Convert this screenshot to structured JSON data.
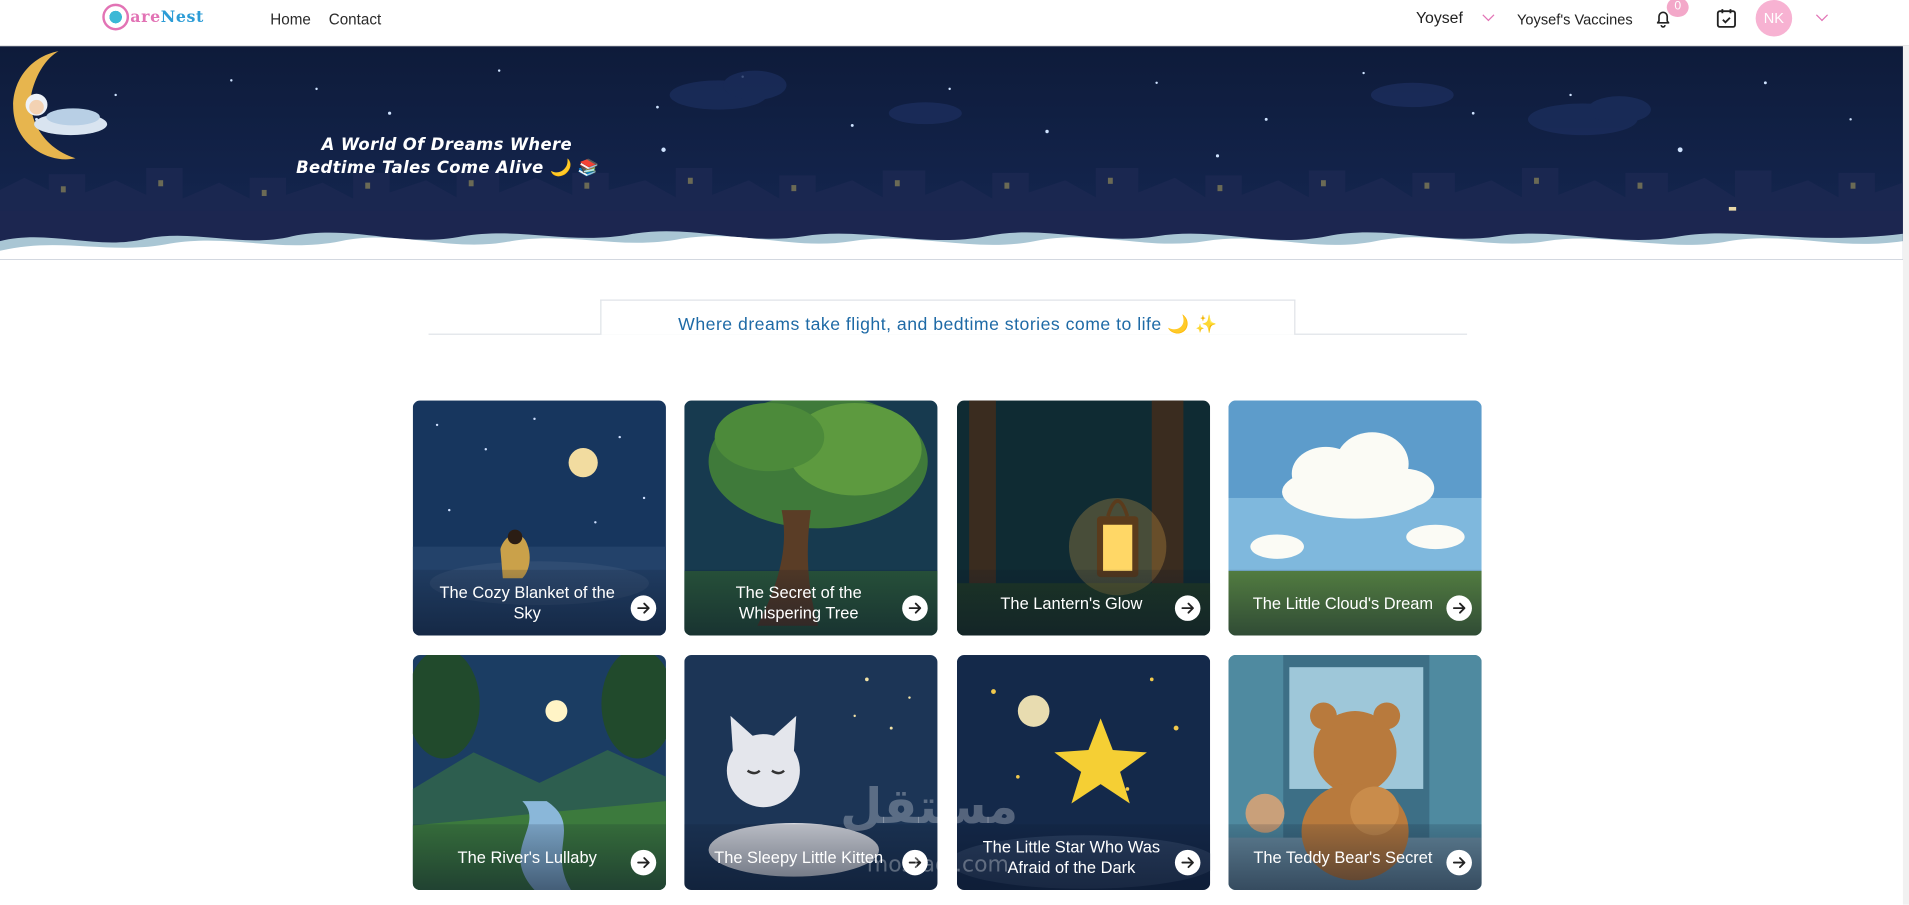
{
  "brand": {
    "name_a": "are",
    "name_b": "Nest",
    "accent": "#e273b5",
    "accent2": "#2c9cd6"
  },
  "nav": {
    "home": "Home",
    "contact": "Contact"
  },
  "user": {
    "name": "Yoysef",
    "vaccines": "Yoysef's Vaccines",
    "notifications": "0",
    "initials": "NK"
  },
  "hero": {
    "line1": "A World Of Dreams Where",
    "line2": "Bedtime Tales Come Alive 🌙 📚"
  },
  "tagline": "Where dreams take flight, and bedtime stories come to life 🌙 ✨",
  "stories": [
    {
      "title": "The Cozy Blanket of the Sky",
      "icon": "arrow-right-icon"
    },
    {
      "title": "The Secret of the Whispering Tree",
      "icon": "arrow-right-icon"
    },
    {
      "title": "The Lantern's Glow",
      "icon": "arrow-right-icon"
    },
    {
      "title": "The Little Cloud's Dream",
      "icon": "arrow-right-icon"
    },
    {
      "title": "The River's Lullaby",
      "icon": "arrow-right-icon"
    },
    {
      "title": "The Sleepy Little Kitten",
      "icon": "arrow-right-icon"
    },
    {
      "title": "The Little Star Who Was Afraid of the Dark",
      "icon": "arrow-right-icon"
    },
    {
      "title": "The Teddy Bear's Secret",
      "icon": "arrow-right-icon"
    }
  ],
  "watermark": {
    "main": "مستقل",
    "sub": "mostaql.com"
  }
}
